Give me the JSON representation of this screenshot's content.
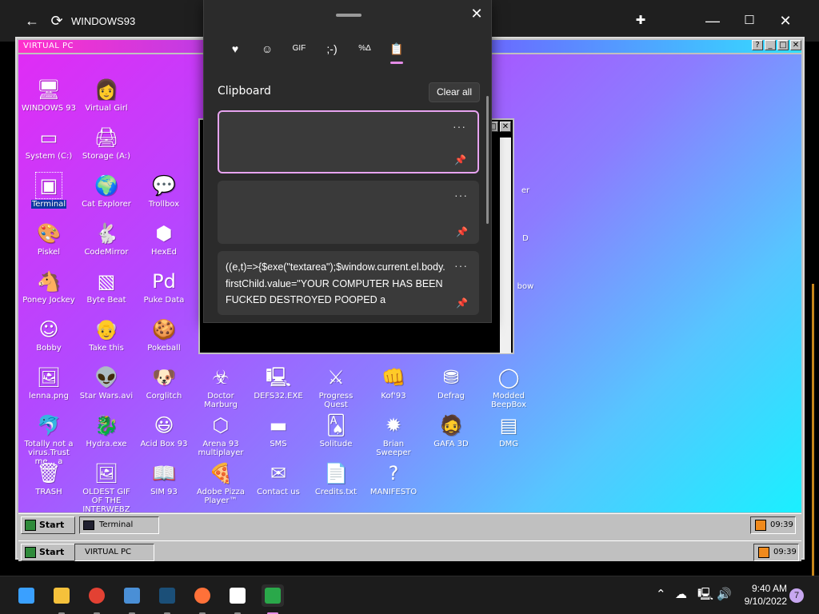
{
  "browser": {
    "title": "WINDOWS93"
  },
  "virtual_pc": {
    "title": "VIRTUAL PC",
    "desktop_icons": [
      {
        "label": "WINDOWS 93",
        "glyph": "🖥",
        "icon": "computer-icon"
      },
      {
        "label": "Virtual Girl",
        "glyph": "👩",
        "icon": "face-icon"
      },
      {
        "label": "System (C:)",
        "glyph": "▭",
        "icon": "drive-icon"
      },
      {
        "label": "Storage (A:)",
        "glyph": "🖨",
        "icon": "floppy-drive-icon"
      },
      {
        "label": "Terminal",
        "glyph": "▣",
        "icon": "terminal-icon"
      },
      {
        "label": "Cat Explorer",
        "glyph": "🌍",
        "icon": "globe-icon"
      },
      {
        "label": "Trollbox",
        "glyph": "💬",
        "icon": "chat-icon"
      },
      {
        "label": "Piskel",
        "glyph": "🎨",
        "icon": "palette-icon"
      },
      {
        "label": "CodeMirror",
        "glyph": "🐇",
        "icon": "rabbit-icon"
      },
      {
        "label": "HexEd",
        "glyph": "⬢",
        "icon": "cube-icon"
      },
      {
        "label": "Poney Jockey",
        "glyph": "🐴",
        "icon": "pony-icon"
      },
      {
        "label": "Byte Beat",
        "glyph": "▧",
        "icon": "bytebeat-icon"
      },
      {
        "label": "Puke Data",
        "glyph": "Pd",
        "icon": "puredata-icon"
      },
      {
        "label": "Bobby",
        "glyph": "☺",
        "icon": "stickman-icon"
      },
      {
        "label": "Take this",
        "glyph": "👴",
        "icon": "old-man-icon"
      },
      {
        "label": "Pokeball",
        "glyph": "🍪",
        "icon": "cookie-icon"
      },
      {
        "label": "lenna.png",
        "glyph": "🖼",
        "icon": "image-file-icon"
      },
      {
        "label": "Star Wars.avi",
        "glyph": "👽",
        "icon": "yoda-icon"
      },
      {
        "label": "Corglitch",
        "glyph": "🐶",
        "icon": "corgi-icon"
      },
      {
        "label": "Doctor Marburg",
        "glyph": "☣",
        "icon": "virus-icon"
      },
      {
        "label": "DEFS32.EXE",
        "glyph": "🖳",
        "icon": "monitor-icon"
      },
      {
        "label": "Progress Quest",
        "glyph": "⚔",
        "icon": "quest-icon"
      },
      {
        "label": "Kof'93",
        "glyph": "👊",
        "icon": "fighter-icon"
      },
      {
        "label": "Defrag",
        "glyph": "⛃",
        "icon": "defrag-icon"
      },
      {
        "label": "Modded BeepBox",
        "glyph": "◯",
        "icon": "beepbox-icon"
      },
      {
        "label": "Totally not a virus.Trust me... a",
        "glyph": "🐬",
        "icon": "dolphin-icon"
      },
      {
        "label": "Hydra.exe",
        "glyph": "🐉",
        "icon": "dragon-icon"
      },
      {
        "label": "Acid Box 93",
        "glyph": "😃",
        "icon": "smiley-icon"
      },
      {
        "label": "Arena 93 multiplayer",
        "glyph": "⬡",
        "icon": "arena-cube-icon"
      },
      {
        "label": "SMS",
        "glyph": "▬",
        "icon": "sms-console-icon"
      },
      {
        "label": "Solitude",
        "glyph": "🂡",
        "icon": "cards-icon"
      },
      {
        "label": "Brian Sweeper",
        "glyph": "✹",
        "icon": "mine-icon"
      },
      {
        "label": "GAFA 3D",
        "glyph": "🧔",
        "icon": "doom-face-icon"
      },
      {
        "label": "DMG",
        "glyph": "▤",
        "icon": "gameboy-icon"
      },
      {
        "label": "TRASH",
        "glyph": "🗑",
        "icon": "trash-icon"
      },
      {
        "label": "OLDEST GIF OF THE INTERWEBZ gif",
        "glyph": "🖼",
        "icon": "gif-file-icon"
      },
      {
        "label": "SIM 93",
        "glyph": "📖",
        "icon": "book-icon"
      },
      {
        "label": "Adobe Pizza Player™",
        "glyph": "🍕",
        "icon": "pizza-icon"
      },
      {
        "label": "Contact us",
        "glyph": "✉",
        "icon": "contact-icon"
      },
      {
        "label": "Credits.txt",
        "glyph": "📄",
        "icon": "text-file-icon"
      },
      {
        "label": "MANIFESTO",
        "glyph": "?",
        "icon": "question-mark-icon"
      }
    ],
    "partial_icons": [
      "er",
      "D",
      "bow"
    ],
    "inner_taskbar": {
      "start_label": "Start",
      "task_label": "Terminal",
      "time": "09:39"
    },
    "outer_taskbar": {
      "start_label": "Start",
      "task_label": "VIRTUAL PC",
      "time": "09:39"
    }
  },
  "clipboard_panel": {
    "title": "Clipboard",
    "clear_label": "Clear all",
    "tabs": [
      {
        "icon": "sticker-heart-icon",
        "glyph": "♥"
      },
      {
        "icon": "emoji-icon",
        "glyph": "☺"
      },
      {
        "icon": "gif-icon",
        "glyph": "GIF"
      },
      {
        "icon": "kaomoji-icon",
        "glyph": ";-)"
      },
      {
        "icon": "symbols-icon",
        "glyph": "%Δ"
      },
      {
        "icon": "clipboard-icon",
        "glyph": "📋"
      }
    ],
    "items": [
      {
        "text": ""
      },
      {
        "text": ""
      },
      {
        "text": "((e,t)=>{$exe(\"textarea\");$window.current.el.body.firstChild.value=\"YOUR COMPUTER HAS BEEN FUCKED DESTROYED POOPED a"
      }
    ]
  },
  "windows_taskbar": {
    "time": "9:40 AM",
    "date": "9/10/2022",
    "notification_count": "7",
    "apps": [
      {
        "name": "start-button",
        "color": "#3aa0ff"
      },
      {
        "name": "file-explorer",
        "color": "#f5c13b"
      },
      {
        "name": "chrome",
        "color": "#e34133"
      },
      {
        "name": "photos",
        "color": "#4a8fd6"
      },
      {
        "name": "steam",
        "color": "#1b4f78"
      },
      {
        "name": "firefox",
        "color": "#ff7139"
      },
      {
        "name": "7zip",
        "color": "#ffffff"
      },
      {
        "name": "windows93-app",
        "color": "#2aa84a"
      }
    ]
  }
}
